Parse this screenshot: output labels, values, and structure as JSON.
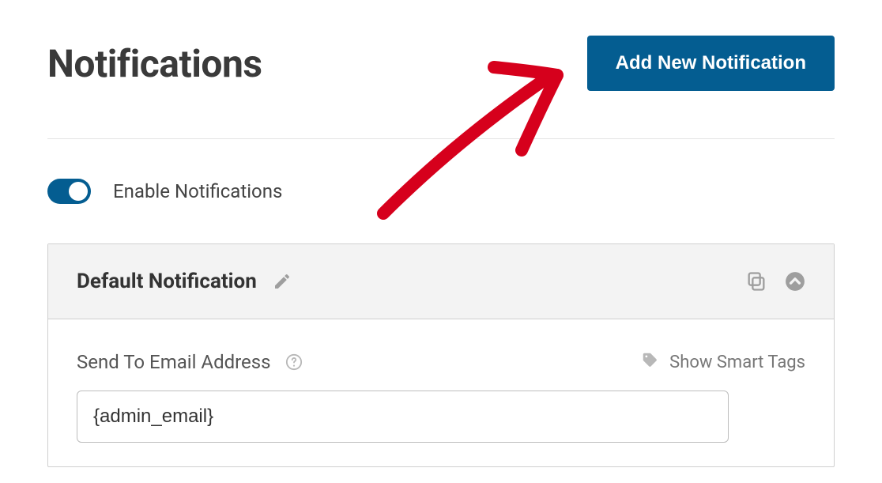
{
  "header": {
    "title": "Notifications",
    "add_button_label": "Add New Notification"
  },
  "enable": {
    "label": "Enable Notifications",
    "on": true
  },
  "panel": {
    "title": "Default Notification",
    "field_label": "Send To Email Address",
    "smart_tags_label": "Show Smart Tags",
    "email_value": "{admin_email}"
  }
}
